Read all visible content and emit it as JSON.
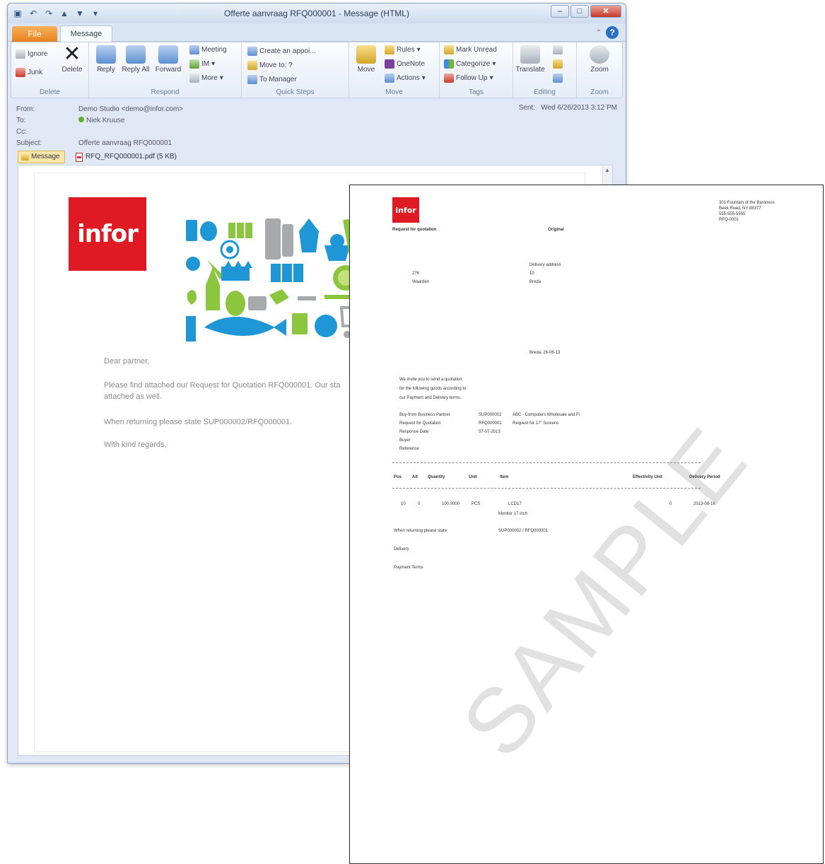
{
  "window": {
    "title": "Offerte aanvraag RFQ000001 - Message (HTML)",
    "qat_icons": [
      "save-icon",
      "undo-icon",
      "redo-icon",
      "up-arrow-icon",
      "down-arrow-icon",
      "customize-icon"
    ],
    "controls": [
      "minimize",
      "maximize",
      "close"
    ]
  },
  "tabs": {
    "file": "File",
    "message": "Message"
  },
  "ribbon": {
    "delete": {
      "label": "Delete",
      "ignore": "Ignore",
      "junk": "Junk",
      "delete_btn": "Delete"
    },
    "respond": {
      "label": "Respond",
      "reply": "Reply",
      "reply_all": "Reply All",
      "forward": "Forward",
      "meeting": "Meeting",
      "im": "IM",
      "more": "More"
    },
    "quick_steps": {
      "label": "Quick Steps",
      "items": [
        "Create an appoi...",
        "Move to: ?",
        "To Manager"
      ]
    },
    "move": {
      "label": "Move",
      "move_btn": "Move",
      "rules": "Rules",
      "onenote": "OneNote",
      "actions": "Actions"
    },
    "tags": {
      "label": "Tags",
      "mark_unread": "Mark Unread",
      "categorize": "Categorize",
      "follow_up": "Follow Up"
    },
    "editing": {
      "label": "Editing",
      "translate": "Translate"
    },
    "zoom": {
      "label": "Zoom",
      "zoom_btn": "Zoom"
    }
  },
  "header": {
    "from_label": "From:",
    "from_value": "Demo Studio <demo@infor.com>",
    "to_label": "To:",
    "to_value": "Niek Kruuse",
    "cc_label": "Cc:",
    "subject_label": "Subject:",
    "subject_value": "Offerte aanvraag RFQ000001",
    "sent_label": "Sent:",
    "sent_value": "Wed 6/26/2013 3:12 PM"
  },
  "attachments": {
    "message_tab": "Message",
    "file": "RFQ_RFQ000001.pdf (5 KB)"
  },
  "email": {
    "logo_text": "infor",
    "greeting": "Dear partner,",
    "line1": "Please find attached our Request for Quotation RFQ000001. Our sta",
    "line2": "attached as well.",
    "line3": "When returning please state SUP000002/RFQ000001.",
    "closing": "With kind regards,"
  },
  "pdf": {
    "logo_text": "infor",
    "title": "Request for quotation",
    "original": "Original",
    "address_block": [
      "301 Fountain of the Baroness",
      "Beek Road, NY 88377",
      "555-555-5555",
      "RFQ-0001"
    ],
    "delivery_block": [
      "Delivery address",
      "10",
      "Breda"
    ],
    "left_block": [
      "276",
      "Waarden"
    ],
    "date_line": "Breda, 26-06-13",
    "intro": [
      "We invite you to send a quotation",
      "for the following goods according to",
      "our Payment and Delivery terms:"
    ],
    "fields": [
      {
        "label": "Buy-from Business Partner",
        "code": "SUP000002",
        "desc": "ABC - Computers Wholesale and Fi"
      },
      {
        "label": "Request for Quotation",
        "code": "RFQ000001",
        "desc": "Request for 17\" Screens"
      },
      {
        "label": "Response Date",
        "code": "07-07-2013",
        "desc": ""
      },
      {
        "label": "Buyer",
        "code": "",
        "desc": ""
      },
      {
        "label": "Reference",
        "code": "",
        "desc": ""
      }
    ],
    "table_headers": [
      "Pos",
      "Alt",
      "Quantity",
      "Unit",
      "Item",
      "Effectivity Unit",
      "Delivery Period"
    ],
    "table_row": [
      "10",
      "0",
      "100.0000",
      "PCS",
      "LCD17",
      "0",
      "2013-08-16"
    ],
    "item_desc": "Monitor 17 inch",
    "state_label": "When returning please state",
    "state_value": "SUP000002 / RFQ000001",
    "delivery_label": "Delivery",
    "payment_label": "Payment Terms",
    "watermark": "SAMPLE"
  },
  "colors": {
    "infor_red": "#e01a22",
    "file_tab": "#e8821e",
    "collage_blue": "#1f97d6",
    "collage_green": "#8cc63f"
  }
}
